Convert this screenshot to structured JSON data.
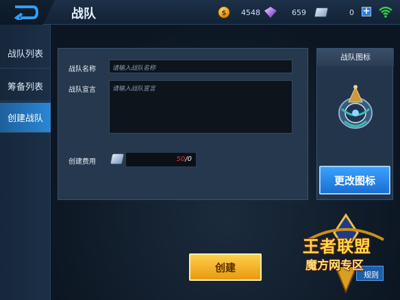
{
  "header": {
    "title": "战队",
    "coins": "4548",
    "gems": "659",
    "tickets": "0",
    "plus_label": "+"
  },
  "sidebar": {
    "items": [
      {
        "label": "战队列表"
      },
      {
        "label": "筹备列表"
      },
      {
        "label": "创建战队",
        "active": true
      }
    ]
  },
  "form": {
    "name_label": "战队名称",
    "name_placeholder": "请输入战队名称",
    "motto_label": "战队宣言",
    "motto_placeholder": "请输入战队宣言",
    "cost_label": "创建费用",
    "cost_current": "50",
    "cost_total": "/0"
  },
  "icon_panel": {
    "title": "战队图标",
    "change_button": "更改图标"
  },
  "actions": {
    "create_button": "创建",
    "rules_button": "规则"
  },
  "watermark": {
    "line1": "王者联盟",
    "line2": "魔方网专区"
  },
  "colors": {
    "accent_blue": "#2a87d6",
    "gold_button": "#e79a0e",
    "cost_red": "#e03a3a"
  }
}
